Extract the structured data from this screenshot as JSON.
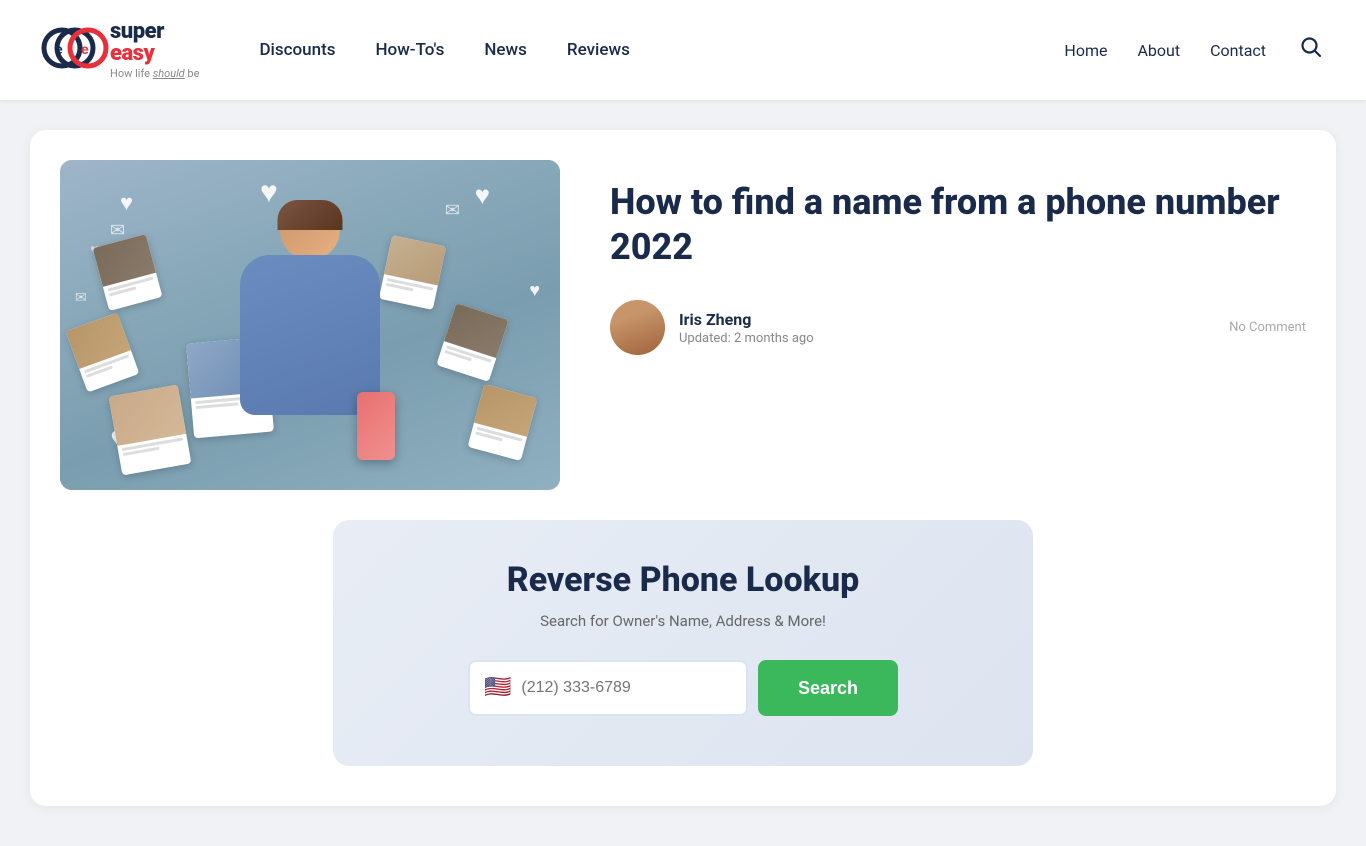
{
  "header": {
    "logo": {
      "super": "super",
      "easy": "easy",
      "tagline_plain": "How life ",
      "tagline_italic": "should",
      "tagline_end": " be"
    },
    "nav": {
      "items": [
        {
          "label": "Discounts",
          "href": "#"
        },
        {
          "label": "How-To's",
          "href": "#"
        },
        {
          "label": "News",
          "href": "#"
        },
        {
          "label": "Reviews",
          "href": "#"
        }
      ]
    },
    "right_nav": {
      "items": [
        {
          "label": "Home",
          "href": "#"
        },
        {
          "label": "About",
          "href": "#"
        },
        {
          "label": "Contact",
          "href": "#"
        }
      ]
    }
  },
  "article": {
    "title": "How to find a name from a phone number 2022",
    "author": {
      "name": "Iris Zheng",
      "updated": "Updated: 2 months ago"
    },
    "no_comment": "No Comment"
  },
  "search_widget": {
    "title": "Reverse Phone Lookup",
    "subtitle": "Search for Owner's Name, Address & More!",
    "input_placeholder": "(212) 333-6789",
    "search_button": "Search"
  }
}
